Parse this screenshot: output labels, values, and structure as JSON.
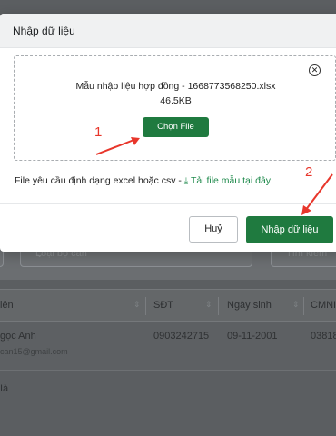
{
  "modal": {
    "title": "Nhập dữ liệu",
    "file_name": "Mẫu nhập liệu hợp đồng - 1668773568250.xlsx",
    "file_size": "46.5KB",
    "choose_file_label": "Chọn File",
    "hint_text": "File yêu cầu định dạng excel hoặc csv - ",
    "download_link": "Tải file mẫu tại đây",
    "cancel_label": "Huỷ",
    "import_label": "Nhập dữ liệu",
    "accent_color": "#1f7a3f"
  },
  "annotations": [
    "1",
    "2"
  ],
  "background": {
    "filter_placeholder": "Loại bộ cán",
    "search_placeholder": "Tìm kiếm",
    "columns": [
      "iên",
      "SĐT",
      "Ngày sinh",
      "CMNI"
    ],
    "rows": [
      {
        "name": "gọc Anh",
        "email": "can15@gmail.com",
        "phone": "0903242715",
        "dob": "09-11-2001",
        "id": "03818"
      }
    ],
    "footer_text": "Ià"
  }
}
